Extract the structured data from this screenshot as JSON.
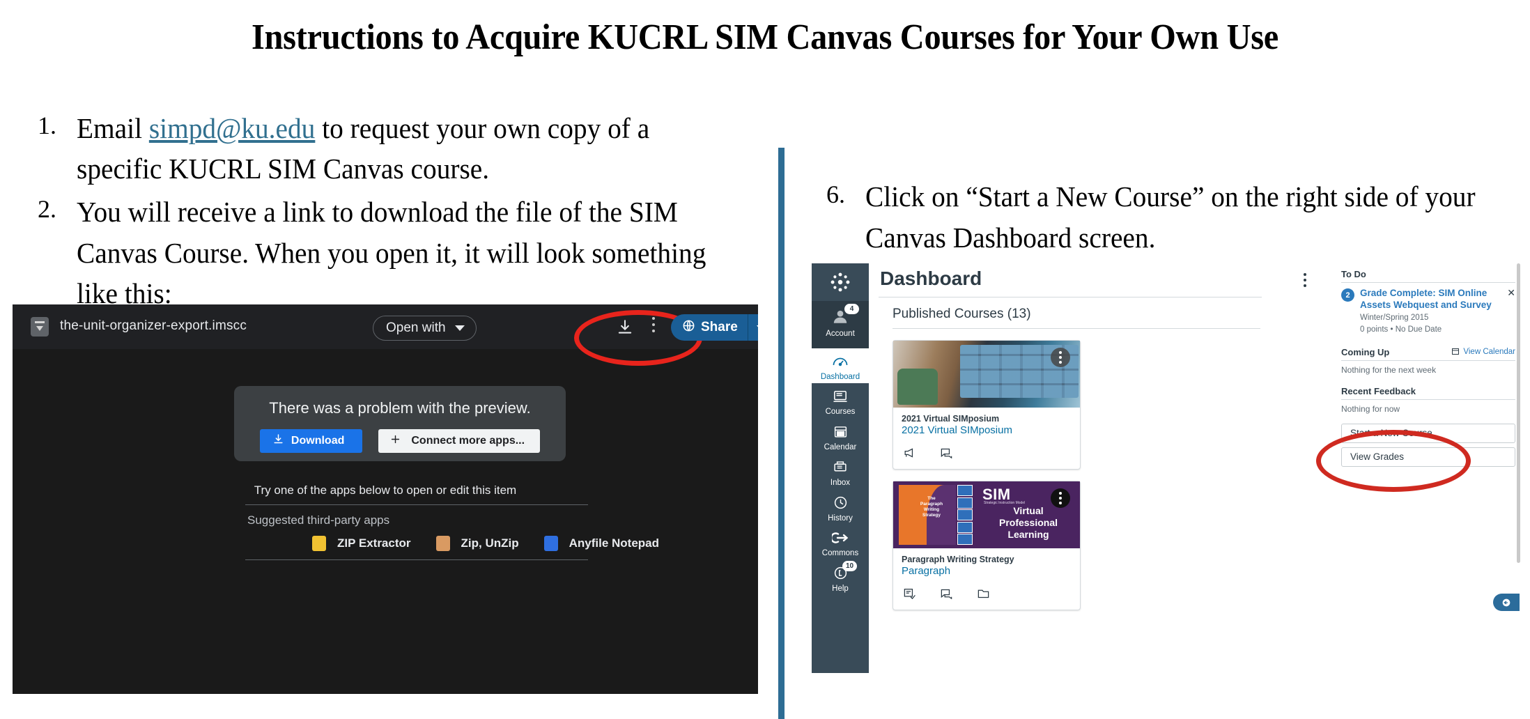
{
  "slide": {
    "title": "Instructions to Acquire KUCRL SIM Canvas Courses for Your Own Use"
  },
  "left_list": [
    {
      "number": "1.",
      "text_before": "Email ",
      "link": "simpd@ku.edu",
      "text_after": " to request your own copy of a specific KUCRL SIM Canvas course."
    },
    {
      "number": "2.",
      "text": "You will receive a link to download the file of the SIM Canvas Course. When you open it, it will look something like this:"
    }
  ],
  "right_list": [
    {
      "number": "6.",
      "text": "Click on “Start a New Course” on the right side of your Canvas Dashboard screen."
    }
  ],
  "drive_preview": {
    "filename": "the-unit-organizer-export.imscc",
    "file_icon": "document-icon",
    "open_with_label": "Open with",
    "download_icon": "download-icon",
    "kebab_icon": "more-options-icon",
    "share_label": "Share",
    "share_globe_icon": "globe-icon",
    "problem_message": "There was a problem with the preview.",
    "download_button": "Download",
    "connect_button": "Connect more apps...",
    "try_line": "Try one of the apps below to open or edit this item",
    "suggested_label": "Suggested third-party apps",
    "apps": [
      {
        "name": "ZIP Extractor",
        "icon_color": "#f1c232"
      },
      {
        "name": "Zip, UnZip",
        "icon_color": "#d99a62"
      },
      {
        "name": "Anyfile Notepad",
        "icon_color": "#2f6fe0"
      }
    ],
    "annotation": "red-ellipse-around-download"
  },
  "canvas": {
    "nav": [
      {
        "label": "Account",
        "icon": "user-avatar-icon",
        "badge": "4",
        "active": false
      },
      {
        "label": "Dashboard",
        "icon": "dashboard-icon",
        "badge": "",
        "active": true
      },
      {
        "label": "Courses",
        "icon": "courses-icon",
        "badge": "",
        "active": false
      },
      {
        "label": "Calendar",
        "icon": "calendar-icon",
        "badge": "",
        "active": false
      },
      {
        "label": "Inbox",
        "icon": "inbox-icon",
        "badge": "",
        "active": false
      },
      {
        "label": "History",
        "icon": "clock-icon",
        "badge": "",
        "active": false
      },
      {
        "label": "Commons",
        "icon": "commons-arrow-icon",
        "badge": "",
        "active": false
      },
      {
        "label": "Help",
        "icon": "help-icon",
        "badge": "10",
        "active": false
      }
    ],
    "logo_icon": "canvas-logo-icon",
    "page_title": "Dashboard",
    "page_kebab": "dashboard-options-icon",
    "section_label": "Published Courses (13)",
    "cards": [
      {
        "term": "2021 Virtual SIMposium",
        "name": "2021 Virtual SIMposium",
        "image": "laptop-video-call-photo",
        "icons": [
          "announcement-icon",
          "discussion-icon"
        ]
      },
      {
        "term": "Paragraph Writing Strategy",
        "name": "Paragraph",
        "image": "sim-virtual-professional-learning-banner",
        "banner_title": "SIM",
        "banner_subtitle": "Strategic Instruction Model",
        "banner_lines": [
          "Virtual",
          "Professional",
          "Learning"
        ],
        "book_cover_lines": [
          "The",
          "Paragraph",
          "Writing",
          "Strategy"
        ],
        "icons": [
          "assignment-icon",
          "discussion-icon",
          "files-icon"
        ]
      }
    ],
    "sidebar": {
      "todo_heading": "To Do",
      "todo_items": [
        {
          "badge": "2",
          "title": "Grade Complete: SIM Online Assets Webquest and Survey",
          "course": "Winter/Spring 2015",
          "meta": "0 points • No Due Date",
          "close_icon": "close-icon"
        }
      ],
      "coming_up_heading": "Coming Up",
      "view_calendar_label": "View Calendar",
      "view_calendar_icon": "calendar-icon",
      "coming_up_note": "Nothing for the next week",
      "recent_feedback_heading": "Recent Feedback",
      "recent_feedback_note": "Nothing for now",
      "buttons": [
        {
          "label": "Start a New Course",
          "highlighted": true
        },
        {
          "label": "View Grades",
          "highlighted": false
        }
      ]
    },
    "chat_icon": "chat-bubble-icon",
    "annotation": "red-ellipse-around-start-a-new-course"
  },
  "colors": {
    "divider": "#2e6d94",
    "link": "#31708f",
    "annotation_red": "#d62b20",
    "canvas_nav": "#394B58",
    "canvas_link": "#0770A3",
    "share_blue": "#1a5e96"
  }
}
